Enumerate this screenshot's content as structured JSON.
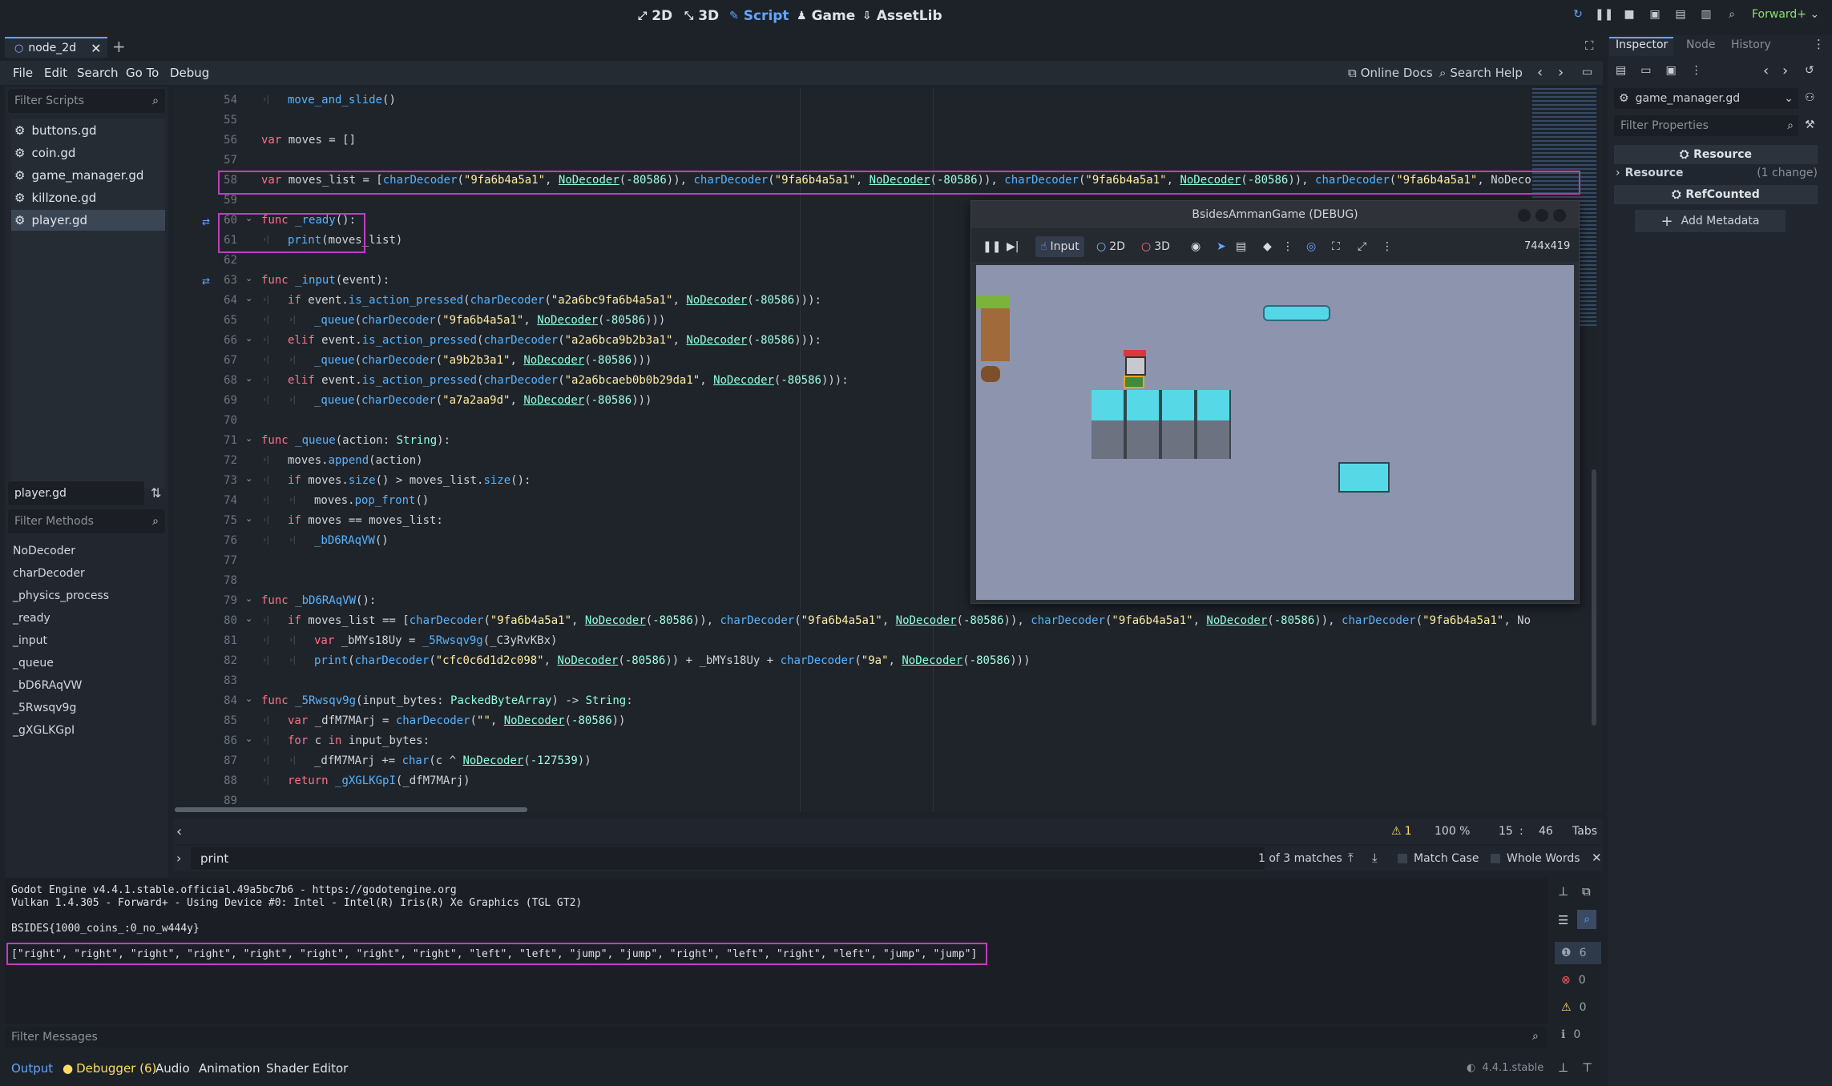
{
  "topbar": {
    "modes": [
      "2D",
      "3D",
      "Script",
      "Game",
      "AssetLib"
    ],
    "active_mode": "Script",
    "renderer": "Forward+"
  },
  "editor": {
    "tab_name": "node_2d",
    "menu": [
      "File",
      "Edit",
      "Search",
      "Go To",
      "Debug"
    ],
    "help_links": [
      "Online Docs",
      "Search Help"
    ]
  },
  "scripts": {
    "filter_placeholder": "Filter Scripts",
    "items": [
      "buttons.gd",
      "coin.gd",
      "game_manager.gd",
      "killzone.gd",
      "player.gd"
    ],
    "selected": "player.gd",
    "current_script": "player.gd",
    "methods_placeholder": "Filter Methods",
    "methods": [
      "NoDecoder",
      "charDecoder",
      "_physics_process",
      "_ready",
      "_input",
      "_queue",
      "_bD6RAqVW",
      "_5Rwsqv9g",
      "_gXGLKGpI"
    ]
  },
  "code_lines": [
    {
      "n": "54",
      "indent": 1,
      "text": "move_and_slide()"
    },
    {
      "n": "55",
      "indent": 0,
      "text": ""
    },
    {
      "n": "56",
      "indent": 0,
      "text": "var moves = []"
    },
    {
      "n": "57",
      "indent": 0,
      "text": ""
    },
    {
      "n": "58",
      "indent": 0,
      "text": "var moves_list = [charDecoder(\"9fa6b4a5a1\", NoDecoder(-80586)), charDecoder(\"9fa6b4a5a1\", NoDecoder(-80586)), charDecoder(\"9fa6b4a5a1\", NoDecoder(-80586)), charDecoder(\"9fa6b4a5a1\", NoDeco"
    },
    {
      "n": "59",
      "indent": 0,
      "text": ""
    },
    {
      "n": "60",
      "indent": 0,
      "text": "func _ready():"
    },
    {
      "n": "61",
      "indent": 1,
      "text": "print(moves_list)"
    },
    {
      "n": "62",
      "indent": 0,
      "text": ""
    },
    {
      "n": "63",
      "indent": 0,
      "text": "func _input(event):"
    },
    {
      "n": "64",
      "indent": 1,
      "text": "if event.is_action_pressed(charDecoder(\"a2a6bc9fa6b4a5a1\", NoDecoder(-80586))):"
    },
    {
      "n": "65",
      "indent": 2,
      "text": "_queue(charDecoder(\"9fa6b4a5a1\", NoDecoder(-80586)))"
    },
    {
      "n": "66",
      "indent": 1,
      "text": "elif event.is_action_pressed(charDecoder(\"a2a6bca9b2b3a1\", NoDecoder(-80586))):"
    },
    {
      "n": "67",
      "indent": 2,
      "text": "_queue(charDecoder(\"a9b2b3a1\", NoDecoder(-80586)))"
    },
    {
      "n": "68",
      "indent": 1,
      "text": "elif event.is_action_pressed(charDecoder(\"a2a6bcaeb0b0b29da1\", NoDecoder(-80586))):"
    },
    {
      "n": "69",
      "indent": 2,
      "text": "_queue(charDecoder(\"a7a2aa9d\", NoDecoder(-80586)))"
    },
    {
      "n": "70",
      "indent": 0,
      "text": ""
    },
    {
      "n": "71",
      "indent": 0,
      "text": "func _queue(action: String):"
    },
    {
      "n": "72",
      "indent": 1,
      "text": "moves.append(action)"
    },
    {
      "n": "73",
      "indent": 1,
      "text": "if moves.size() > moves_list.size():"
    },
    {
      "n": "74",
      "indent": 2,
      "text": "moves.pop_front()"
    },
    {
      "n": "75",
      "indent": 1,
      "text": "if moves == moves_list:"
    },
    {
      "n": "76",
      "indent": 2,
      "text": "_bD6RAqVW()"
    },
    {
      "n": "77",
      "indent": 0,
      "text": ""
    },
    {
      "n": "78",
      "indent": 0,
      "text": ""
    },
    {
      "n": "79",
      "indent": 0,
      "text": "func _bD6RAqVW():"
    },
    {
      "n": "80",
      "indent": 1,
      "text": "if moves_list == [charDecoder(\"9fa6b4a5a1\", NoDecoder(-80586)), charDecoder(\"9fa6b4a5a1\", NoDecoder(-80586)), charDecoder(\"9fa6b4a5a1\", NoDecoder(-80586)), charDecoder(\"9fa6b4a5a1\", No"
    },
    {
      "n": "81",
      "indent": 2,
      "text": "var _bMYs18Uy = _5Rwsqv9g(_C3yRvKBx)"
    },
    {
      "n": "82",
      "indent": 2,
      "text": "print(charDecoder(\"cfc0c6d1d2c098\", NoDecoder(-80586)) + _bMYs18Uy + charDecoder(\"9a\", NoDecoder(-80586)))"
    },
    {
      "n": "83",
      "indent": 0,
      "text": ""
    },
    {
      "n": "84",
      "indent": 0,
      "text": "func _5Rwsqv9g(input_bytes: PackedByteArray) -> String:"
    },
    {
      "n": "85",
      "indent": 1,
      "text": "var _dfM7MArj = charDecoder(\"\", NoDecoder(-80586))"
    },
    {
      "n": "86",
      "indent": 1,
      "text": "for c in input_bytes:"
    },
    {
      "n": "87",
      "indent": 2,
      "text": "_dfM7MArj += char(c ^ NoDecoder(-127539))"
    },
    {
      "n": "88",
      "indent": 1,
      "text": "return _gXGLKGpI(_dfM7MArj)"
    },
    {
      "n": "89",
      "indent": 0,
      "text": ""
    }
  ],
  "game_window": {
    "title": "BsidesAmmanGame (DEBUG)",
    "tools": [
      "Input",
      "2D",
      "3D"
    ],
    "resolution": "744x419"
  },
  "status": {
    "warnings": "1",
    "zoom": "100 %",
    "line": "15",
    "col": "46",
    "indent_mode": "Tabs"
  },
  "find": {
    "query": "print",
    "matches": "1 of 3 matches",
    "match_case": "Match Case",
    "whole_words": "Whole Words"
  },
  "output": {
    "lines": [
      "Godot Engine v4.4.1.stable.official.49a5bc7b6 - https://godotengine.org",
      "Vulkan 1.4.305 - Forward+ - Using Device #0: Intel - Intel(R) Iris(R) Xe Graphics (TGL GT2)",
      "",
      "BSIDES{1000_coins_:0_no_w444y}",
      "",
      "[\"right\", \"right\", \"right\", \"right\", \"right\", \"right\", \"right\", \"right\", \"left\", \"left\", \"jump\", \"jump\", \"right\", \"left\", \"right\", \"left\", \"jump\", \"jump\"]"
    ],
    "filter_placeholder": "Filter Messages",
    "counts": [
      "6",
      "0",
      "0",
      "0"
    ],
    "tabs": [
      "Output",
      "Debugger (6)",
      "Audio",
      "Animation",
      "Shader Editor"
    ],
    "version": "4.4.1.stable"
  },
  "inspector": {
    "tabs": [
      "Inspector",
      "Node",
      "History"
    ],
    "resource_file": "game_manager.gd",
    "filter_placeholder": "Filter Properties",
    "section_resource": "Resource",
    "resource_row": "Resource",
    "resource_change": "(1 change)",
    "refcounted": "RefCounted",
    "add_metadata": "Add Metadata"
  }
}
